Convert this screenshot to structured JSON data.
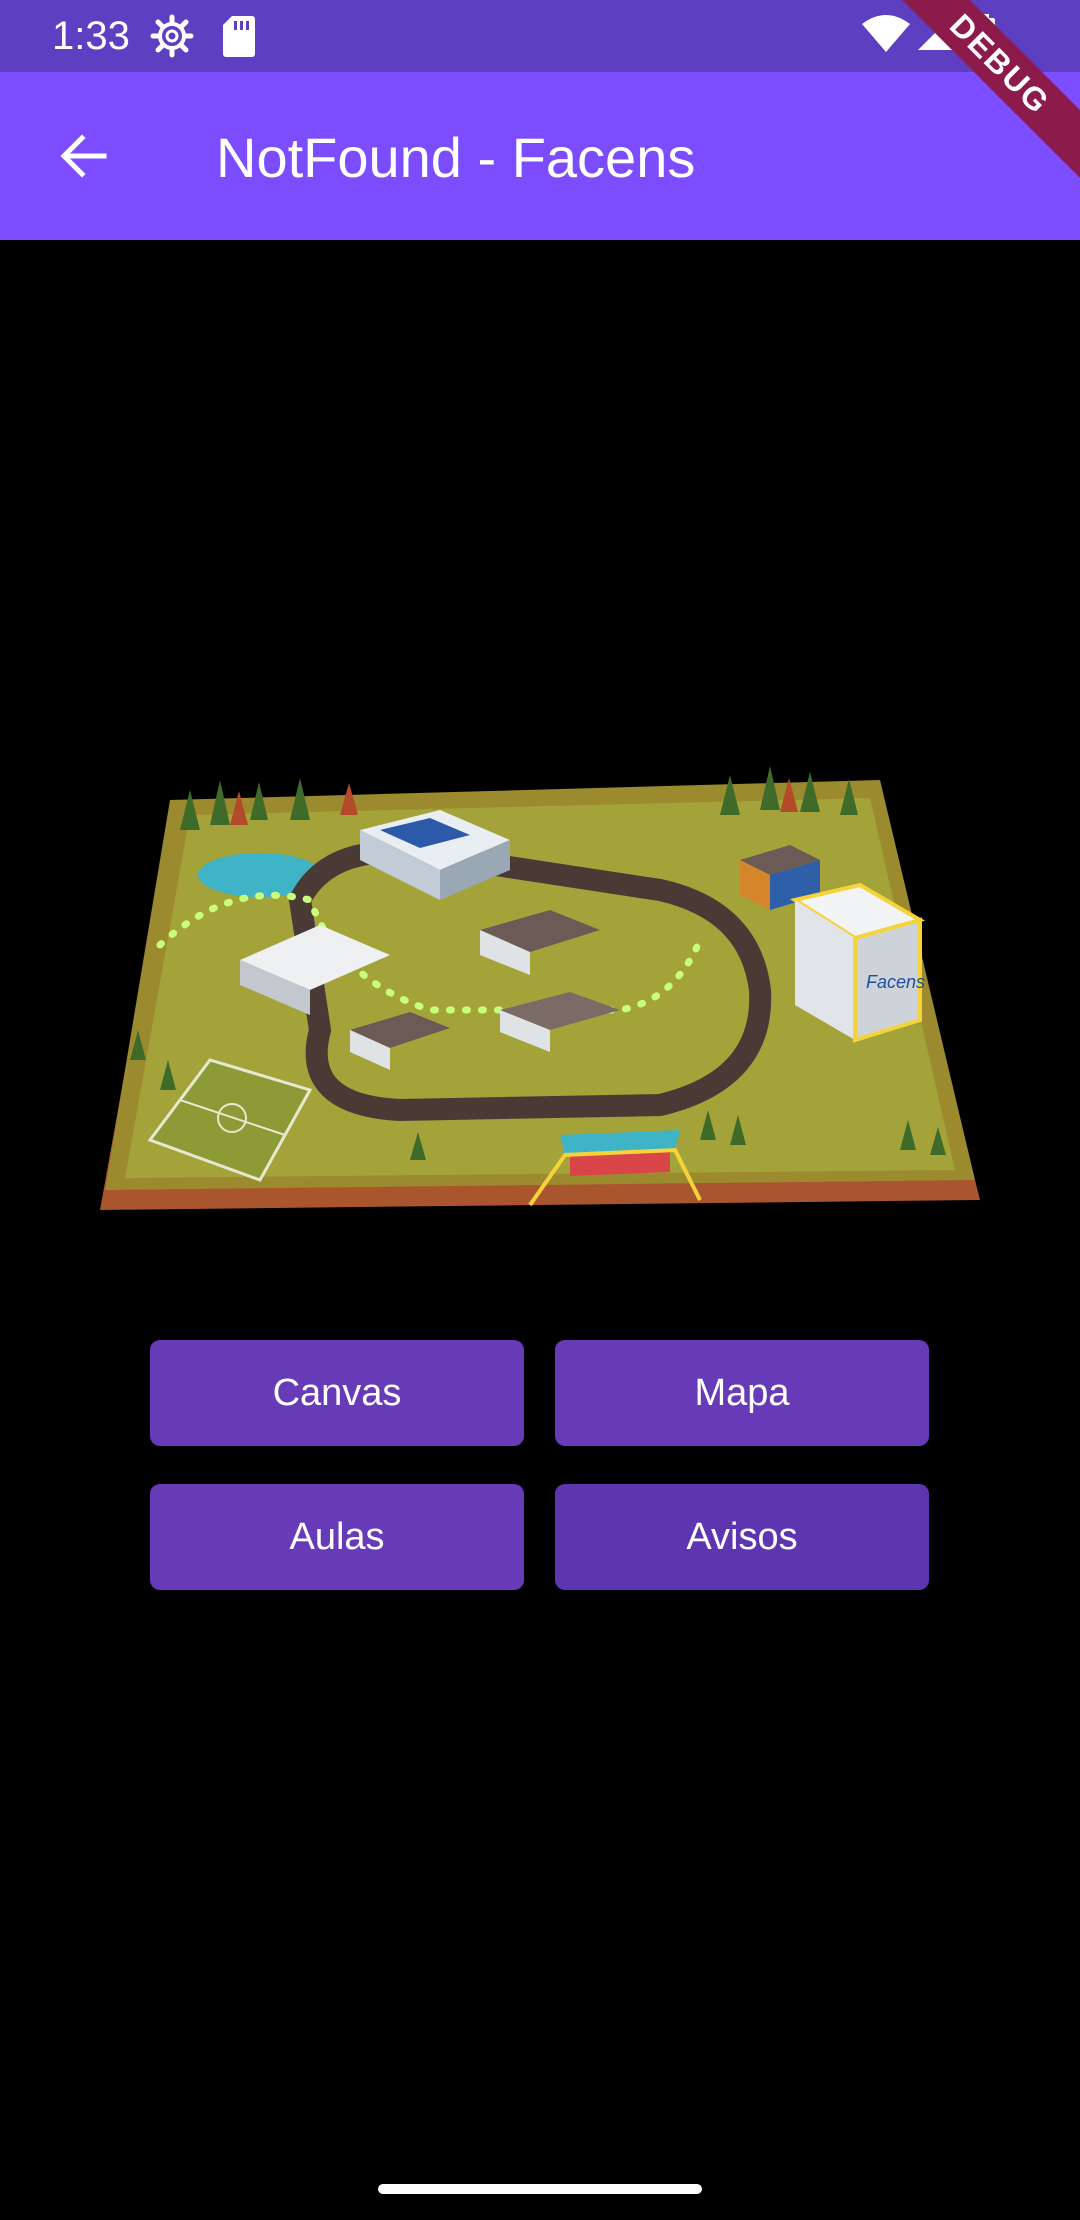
{
  "status_bar": {
    "time": "1:33"
  },
  "app_bar": {
    "title": "NotFound - Facens",
    "debug_label": "DEBUG"
  },
  "campus": {
    "logo_text": "Facens"
  },
  "buttons": {
    "canvas": "Canvas",
    "mapa": "Mapa",
    "aulas": "Aulas",
    "avisos": "Avisos"
  },
  "colors": {
    "status_bar": "#5d3fc2",
    "app_bar": "#7c4dff",
    "button": "#673ab7",
    "button_active": "#5e35b1",
    "background": "#000000"
  }
}
